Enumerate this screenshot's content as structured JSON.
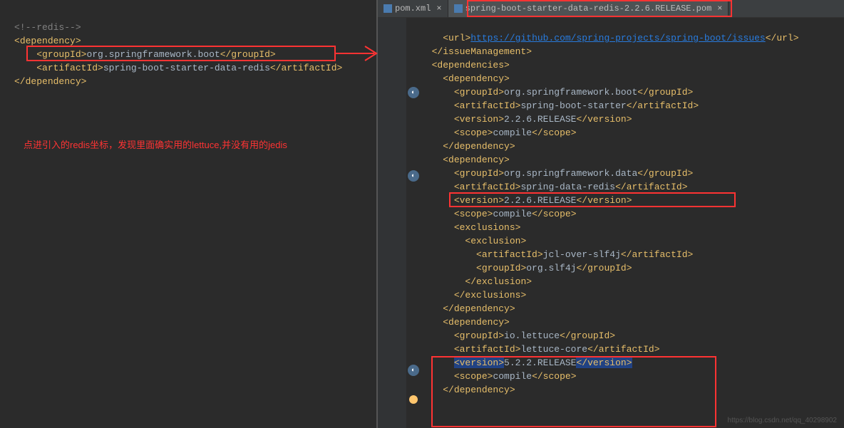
{
  "tabs": {
    "pom_xml": "pom.xml",
    "redis_pom": "spring-boot-starter-data-redis-2.2.6.RELEASE.pom"
  },
  "left_code": {
    "comment": "<!--redis-->",
    "dep_open": "dependency",
    "groupId_tag": "groupId",
    "groupId_val": "org.springframework.boot",
    "artifactId_tag": "artifactId",
    "artifactId_val": "spring-boot-starter-data-redis",
    "dep_close": "dependency"
  },
  "annotation": "点进引入的redis坐标，发现里面确实用的lettuce,并没有用的jedis",
  "right_code": {
    "url_tag": "url",
    "url_val": "https://github.com/spring-projects/spring-boot/issues",
    "issueManagement": "issueManagement",
    "dependencies": "dependencies",
    "dependency": "dependency",
    "groupId": "groupId",
    "artifactId": "artifactId",
    "version": "version",
    "scope": "scope",
    "exclusions": "exclusions",
    "exclusion": "exclusion",
    "dep1": {
      "groupId": "org.springframework.boot",
      "artifactId": "spring-boot-starter",
      "version": "2.2.6.RELEASE",
      "scope": "compile"
    },
    "dep2": {
      "groupId": "org.springframework.data",
      "artifactId": "spring-data-redis",
      "version": "2.2.6.RELEASE",
      "scope": "compile",
      "excl_artifactId": "jcl-over-slf4j",
      "excl_groupId": "org.slf4j"
    },
    "dep3": {
      "groupId": "io.lettuce",
      "artifactId": "lettuce-core",
      "version": "5.2.2.RELEASE",
      "scope": "compile"
    }
  },
  "watermark": "https://blog.csdn.net/qq_40298902"
}
